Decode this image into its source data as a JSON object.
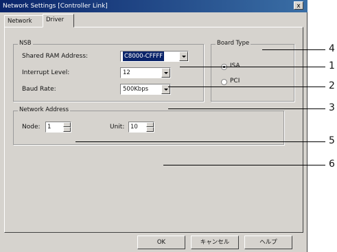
{
  "window": {
    "title": "Network Settings [Controller Link]",
    "close_label": "x"
  },
  "tabs": [
    {
      "label": "Network"
    },
    {
      "label": "Driver"
    }
  ],
  "nsb": {
    "group_label": "NSB",
    "shared_ram_label": "Shared RAM Address:",
    "shared_ram_value": "C8000-CFFFF",
    "interrupt_label": "Interrupt Level:",
    "interrupt_value": "12",
    "baud_label": "Baud Rate:",
    "baud_value": "500Kbps"
  },
  "board_type": {
    "group_label": "Board Type",
    "options": [
      {
        "label": "ISA",
        "checked": true
      },
      {
        "label": "PCI",
        "checked": false
      }
    ]
  },
  "network_address": {
    "group_label": "Network Address",
    "node_label": "Node:",
    "node_value": "1",
    "unit_label": "Unit:",
    "unit_value": "10"
  },
  "buttons": {
    "ok": "OK",
    "cancel": "キャンセル",
    "help": "ヘルプ"
  },
  "callouts": [
    "1",
    "2",
    "3",
    "4",
    "5",
    "6"
  ]
}
